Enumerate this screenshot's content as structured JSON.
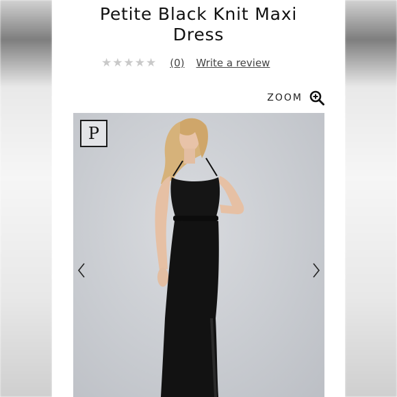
{
  "product": {
    "title_line1": "Petite Black Knit Maxi",
    "title_line2": "Dress",
    "review_count": "(0)",
    "write_review": "Write a review",
    "rating_stars": 0,
    "rating_max": 5
  },
  "zoom": {
    "label": "ZOOM",
    "icon": "zoom-in-icon"
  },
  "gallery": {
    "badge": "P",
    "prev_icon": "chevron-left-icon",
    "next_icon": "chevron-right-icon",
    "image": "model-in-black-maxi-dress-photo"
  },
  "colors": {
    "star_empty": "#c9c9c9",
    "text": "#111111",
    "link": "#444444",
    "photo_bg": "#c9ccd1"
  }
}
